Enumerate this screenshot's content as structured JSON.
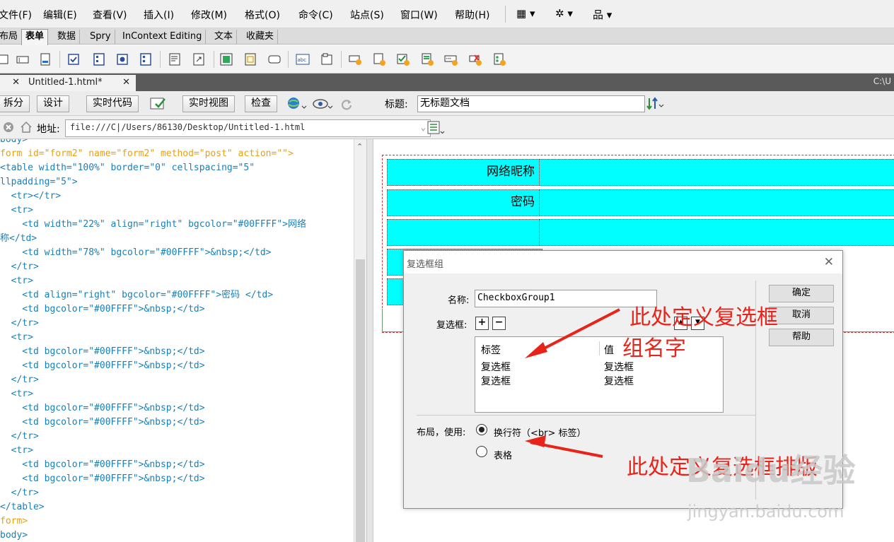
{
  "menu": {
    "items": [
      "文件(F)",
      "编辑(E)",
      "查看(V)",
      "插入(I)",
      "修改(M)",
      "格式(O)",
      "命令(C)",
      "站点(S)",
      "窗口(W)",
      "帮助(H)"
    ],
    "layout_glyph": "▦ ▾",
    "extend_glyph": "✲ ▾",
    "site_glyph": "品 ▾"
  },
  "insert_panel": {
    "tabs": [
      "布局",
      "表单",
      "数据",
      "Spry",
      "InContext Editing",
      "文本",
      "收藏夹"
    ],
    "active_tab": "表单"
  },
  "doc_tabs": {
    "tab_label": "Untitled-1.html*",
    "close_glyph": "✕",
    "path_hint": "C:\\U"
  },
  "doc_toolbar": {
    "split": "拆分",
    "design": "设计",
    "live_code": "实时代码",
    "live_view": "实时视图",
    "inspect": "检查",
    "title_label": "标题:",
    "title_value": "无标题文档"
  },
  "address_bar": {
    "label": "地址:",
    "value": "file:///C|/Users/86130/Desktop/Untitled-1.html"
  },
  "code_lines": [
    "body>",
    "form id=\"form2\" name=\"form2\" method=\"post\" action=\"\">",
    "<table width=\"100%\" border=\"0\" cellspacing=\"5\"",
    "llpadding=\"5\">",
    "  <tr></tr>",
    "  <tr>",
    "    <td width=\"22%\" align=\"right\" bgcolor=\"#00FFFF\">网络",
    "称</td>",
    "    <td width=\"78%\" bgcolor=\"#00FFFF\">&nbsp;</td>",
    "  </tr>",
    "  <tr>",
    "    <td align=\"right\" bgcolor=\"#00FFFF\">密码 </td>",
    "    <td bgcolor=\"#00FFFF\">&nbsp;</td>",
    "  </tr>",
    "  <tr>",
    "    <td bgcolor=\"#00FFFF\">&nbsp;</td>",
    "    <td bgcolor=\"#00FFFF\">&nbsp;</td>",
    "  </tr>",
    "  <tr>",
    "    <td bgcolor=\"#00FFFF\">&nbsp;</td>",
    "    <td bgcolor=\"#00FFFF\">&nbsp;</td>",
    "  </tr>",
    "  <tr>",
    "    <td bgcolor=\"#00FFFF\">&nbsp;</td>",
    "    <td bgcolor=\"#00FFFF\">&nbsp;</td>",
    "  </tr>",
    "</table>",
    "form>",
    "body>"
  ],
  "design_view": {
    "row1_label": "网络昵称",
    "row2_label": "密码",
    "cell_color": "#00FFFF"
  },
  "dialog": {
    "title": "复选框组",
    "close_glyph": "✕",
    "name_label": "名称:",
    "name_value": "CheckboxGroup1",
    "checkbox_label": "复选框:",
    "add_glyph": "+",
    "remove_glyph": "−",
    "up_glyph": "▲",
    "down_glyph": "▼",
    "list_header_label": "标签",
    "list_header_value": "值",
    "list_rows": [
      {
        "label": "复选框",
        "value": "复选框"
      },
      {
        "label": "复选框",
        "value": "复选框"
      }
    ],
    "layout_label": "布局，使用:",
    "radio_br": "换行符（<br> 标签）",
    "radio_table": "表格",
    "ok": "确定",
    "cancel": "取消",
    "help": "帮助"
  },
  "annotations": {
    "note1_line1": "此处定义复选框",
    "note1_line2": "组名字",
    "note2": "此处定义复选框排版",
    "color": "#E8241A"
  },
  "watermark": {
    "brand": "Baidu经验",
    "url": "jingyan.baidu.com"
  }
}
